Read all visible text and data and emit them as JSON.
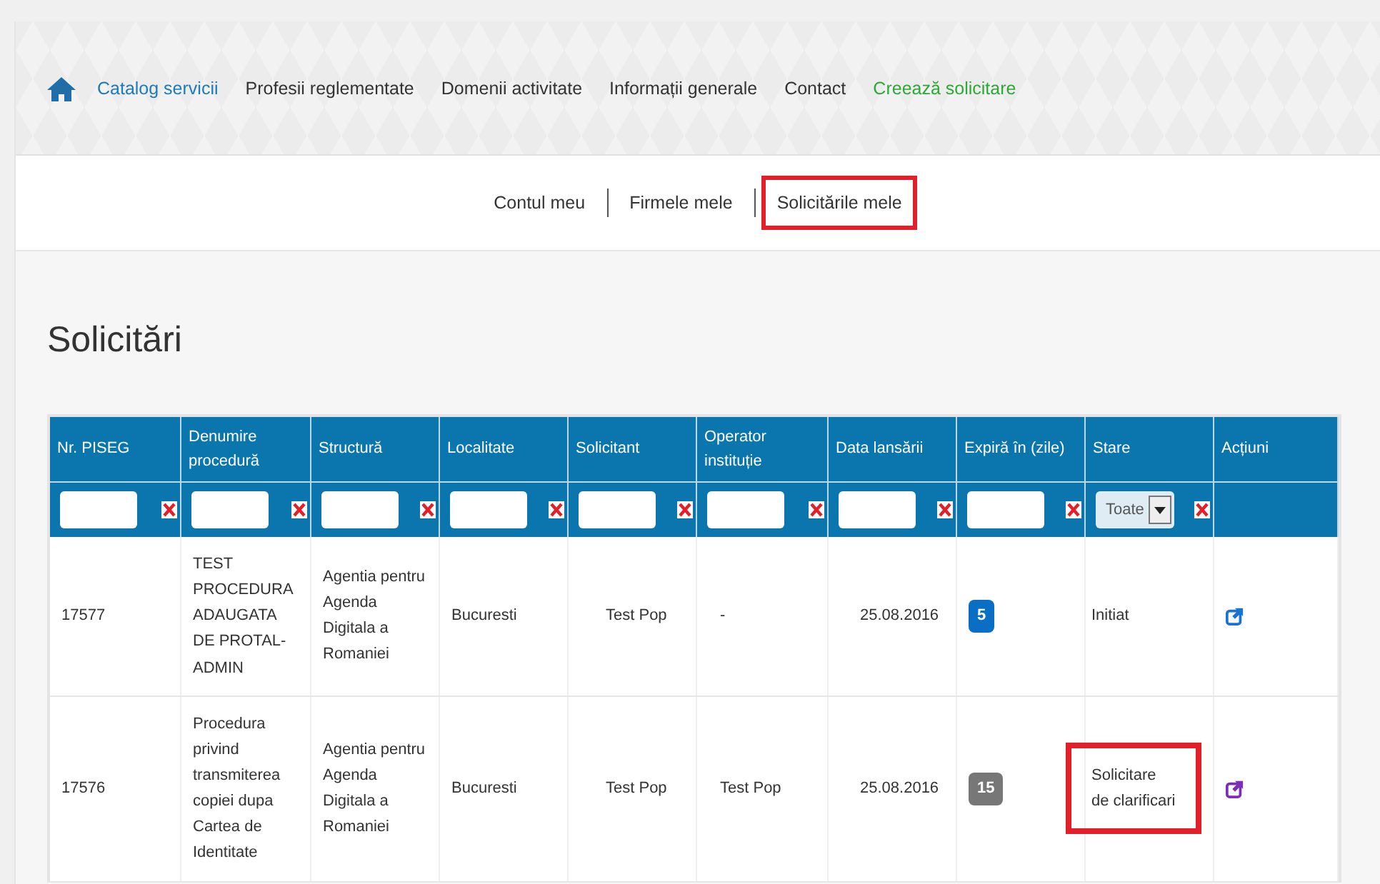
{
  "nav": {
    "items": [
      {
        "label": "Catalog servicii",
        "kind": "link"
      },
      {
        "label": "Profesii reglementate",
        "kind": "plain"
      },
      {
        "label": "Domenii activitate",
        "kind": "plain"
      },
      {
        "label": "Informații generale",
        "kind": "plain"
      },
      {
        "label": "Contact",
        "kind": "plain"
      },
      {
        "label": "Creează solicitare",
        "kind": "action"
      }
    ]
  },
  "subnav": [
    {
      "label": "Contul meu",
      "highlighted": false
    },
    {
      "label": "Firmele mele",
      "highlighted": false
    },
    {
      "label": "Solicitările mele",
      "highlighted": true
    }
  ],
  "title": "Solicitări",
  "table": {
    "columns": [
      "Nr. PISEG",
      "Denumire procedură",
      "Structură",
      "Localitate",
      "Solicitant",
      "Operator instituție",
      "Data lansării",
      "Expiră în (zile)",
      "Stare",
      "Acțiuni"
    ],
    "filters": [
      {
        "kind": "text"
      },
      {
        "kind": "text"
      },
      {
        "kind": "text"
      },
      {
        "kind": "text"
      },
      {
        "kind": "text"
      },
      {
        "kind": "text"
      },
      {
        "kind": "text"
      },
      {
        "kind": "text"
      },
      {
        "kind": "select",
        "value": "Toate"
      },
      {
        "kind": "none"
      }
    ],
    "rows": [
      {
        "nr": "17577",
        "procedure": "TEST PROCEDURA ADAUGATA DE PROTAL-ADMIN",
        "structure": "Agentia pentru Agenda Digitala a Romaniei",
        "locality": "Bucuresti",
        "applicant": "Test Pop",
        "operator": "-",
        "date": "25.08.2016",
        "expires": {
          "text": "5",
          "color": "#0a6fc4"
        },
        "status": {
          "text": "Initiat",
          "highlighted": false
        },
        "action": {
          "color": "#1a73d1"
        }
      },
      {
        "nr": "17576",
        "procedure": "Procedura privind transmiterea copiei dupa Cartea de Identitate",
        "structure": "Agentia pentru Agenda Digitala a Romaniei",
        "locality": "Bucuresti",
        "applicant": "Test Pop",
        "operator": "Test Pop",
        "date": "25.08.2016",
        "expires": {
          "text": "15",
          "color": "#777777"
        },
        "status": {
          "text": "Solicitare de clarificari",
          "highlighted": true
        },
        "action": {
          "color": "#7b2fb5"
        }
      }
    ]
  }
}
